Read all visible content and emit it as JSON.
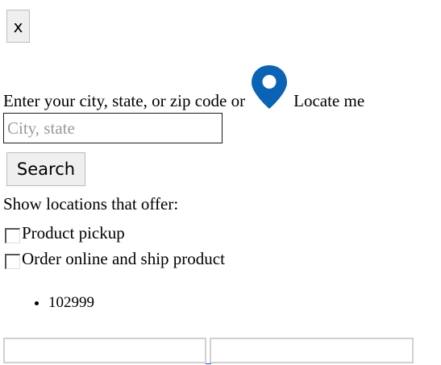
{
  "close_button": {
    "label": "x"
  },
  "location_prompt": {
    "text": "Enter your city, state, or zip code or",
    "locate_label": "Locate me",
    "pin_color": "#0b63b5"
  },
  "search": {
    "value": "",
    "placeholder": "City, state",
    "button_label": "Search"
  },
  "filters": {
    "heading": "Show locations that offer:",
    "options": [
      {
        "label": "Product pickup",
        "checked": false
      },
      {
        "label": "Order online and ship product",
        "checked": false
      }
    ]
  },
  "results": [
    "102999"
  ]
}
